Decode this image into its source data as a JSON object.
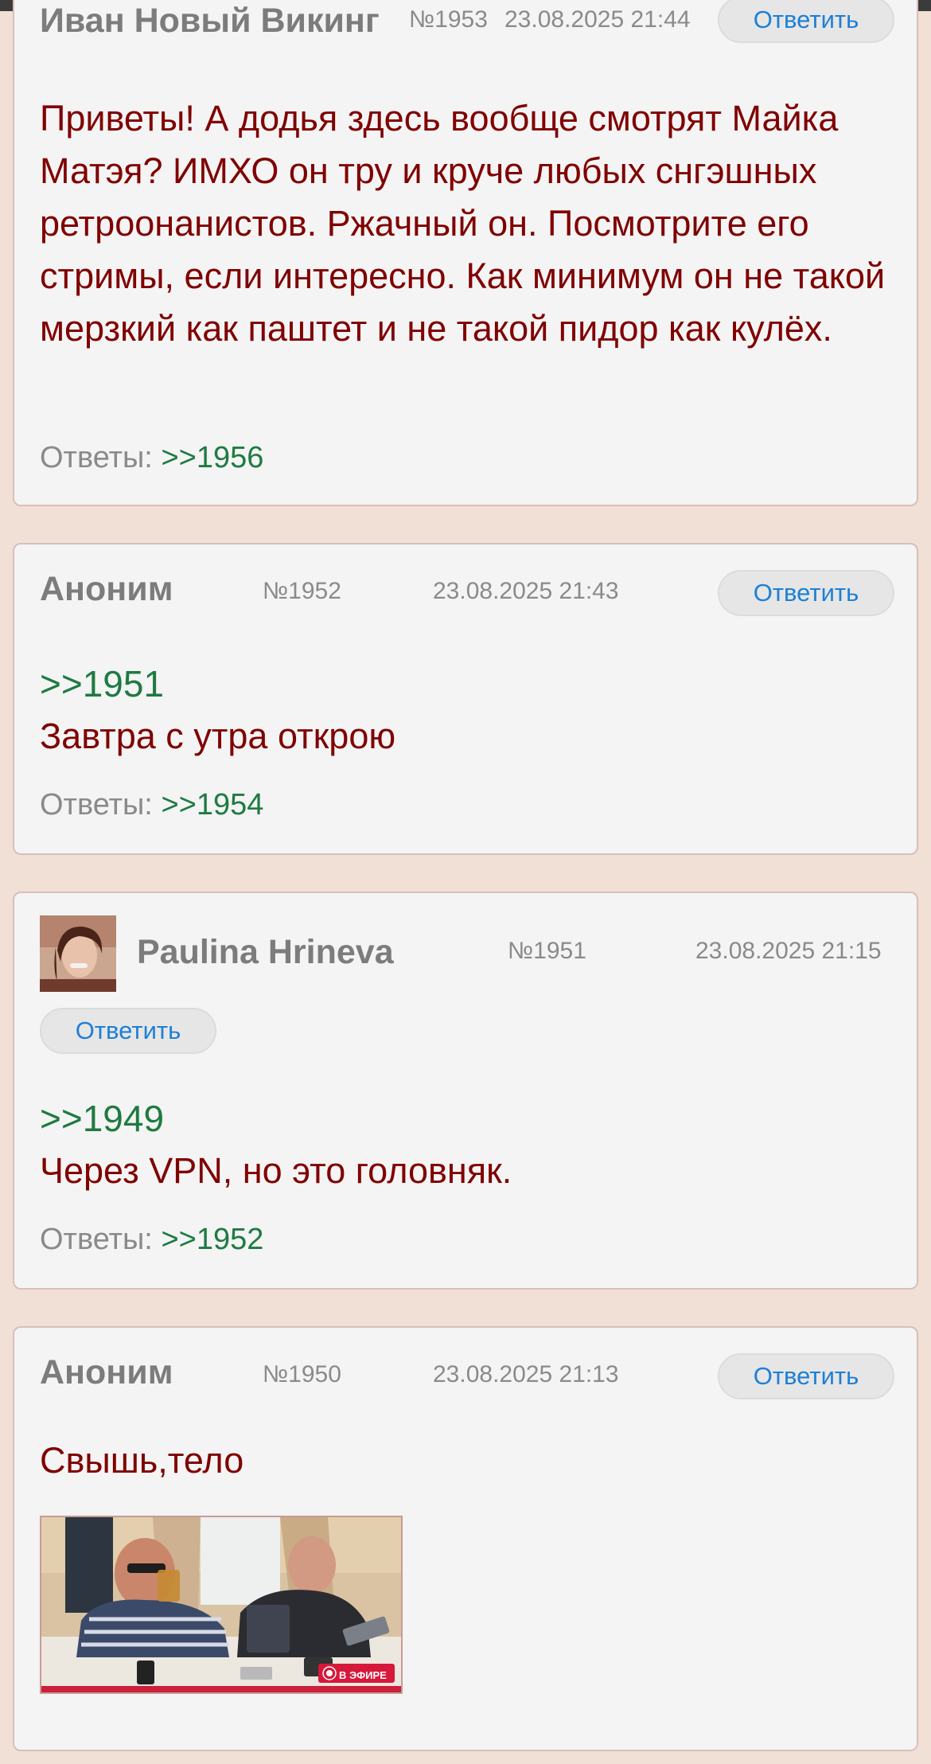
{
  "posts": [
    {
      "author": "Иван Новый Викинг",
      "num": "№1953",
      "date": "23.08.2025 21:44",
      "reply_label": "Ответить",
      "text": "Приветы! А додья здесь вообще смотрят Майка Матэя? ИМХО он тру и круче любых снгэшных ретроонанистов. Ржачный он. Посмотрите его стримы, если интересно. Как минимум он не такой мерзкий как паштет и не такой пидор как кулёх.",
      "answers_label": "Ответы:",
      "answers_link": ">>1956"
    },
    {
      "author": "Аноним",
      "num": "№1952",
      "date": "23.08.2025 21:43",
      "reply_label": "Ответить",
      "quote": ">>1951",
      "text": "Завтра с утра открою",
      "answers_label": "Ответы:",
      "answers_link": ">>1954"
    },
    {
      "author": "Paulina Hrineva",
      "num": "№1951",
      "date": "23.08.2025 21:15",
      "reply_label": "Ответить",
      "quote": ">>1949",
      "text": "Через VPN, но это головняк.",
      "answers_label": "Ответы:",
      "answers_link": ">>1952"
    },
    {
      "author": "Аноним",
      "num": "№1950",
      "date": "23.08.2025 21:13",
      "reply_label": "Ответить",
      "text": "Свышь,тело",
      "live_badge": "В ЭФИРЕ"
    }
  ]
}
